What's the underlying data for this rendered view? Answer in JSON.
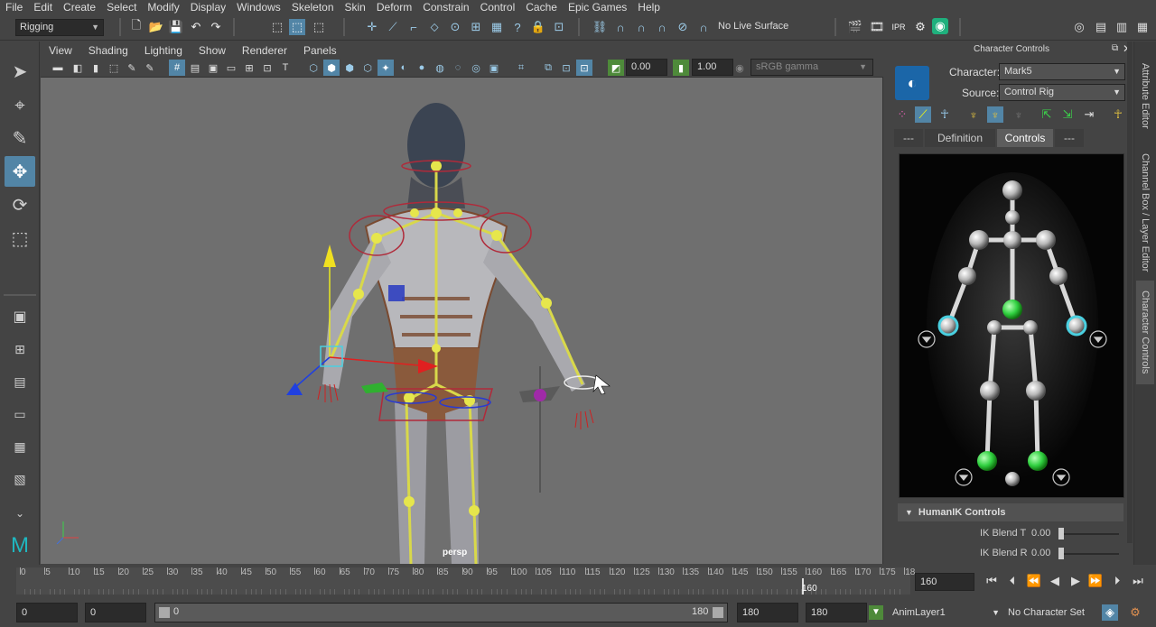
{
  "menubar": {
    "items": [
      "File",
      "Edit",
      "Create",
      "Select",
      "Modify",
      "Display",
      "Windows",
      "Skeleton",
      "Skin",
      "Deform",
      "Constrain",
      "Control",
      "Cache",
      "Epic Games",
      "Help"
    ]
  },
  "shelf": {
    "mode": "Rigging",
    "live_surface": "No Live Surface"
  },
  "viewport_menu": {
    "items": [
      "View",
      "Shading",
      "Lighting",
      "Show",
      "Renderer",
      "Panels"
    ]
  },
  "viewport_toolbar": {
    "exposure": "0.00",
    "gamma": "1.00",
    "color_space": "sRGB gamma"
  },
  "viewport": {
    "camera_label": "persp"
  },
  "character_controls": {
    "title": "Character Controls",
    "character_label": "Character:",
    "character_value": "Mark5",
    "source_label": "Source:",
    "source_value": "Control Rig",
    "tabs": [
      "---",
      "Definition",
      "Controls",
      "---"
    ],
    "humanik_section": "HumanIK Controls",
    "blend_t_label": "IK Blend T",
    "blend_t_value": "0.00",
    "blend_r_label": "IK Blend R",
    "blend_r_value": "0.00"
  },
  "side_tabs": [
    "Attribute Editor",
    "Channel Box / Layer Editor",
    "Character Controls"
  ],
  "timeline": {
    "ticks": [
      "0",
      "5",
      "10",
      "15",
      "20",
      "25",
      "30",
      "35",
      "40",
      "45",
      "50",
      "55",
      "60",
      "65",
      "70",
      "75",
      "80",
      "85",
      "90",
      "95",
      "100",
      "105",
      "110",
      "115",
      "120",
      "125",
      "130",
      "135",
      "140",
      "145",
      "150",
      "155",
      "160",
      "165",
      "170",
      "175",
      "18"
    ],
    "current_frame_marker": "160",
    "current_frame": "160"
  },
  "range": {
    "start": "0",
    "playback_start": "0",
    "slider_start": "0",
    "slider_end": "180",
    "playback_end": "180",
    "end": "180",
    "anim_layer": "AnimLayer1",
    "character_set": "No Character Set"
  },
  "colors": {
    "accent": "#5285a6",
    "bone": "#d8d84a",
    "green_effector": "#3be04a",
    "viewport_bg": "#6f6f6f"
  }
}
